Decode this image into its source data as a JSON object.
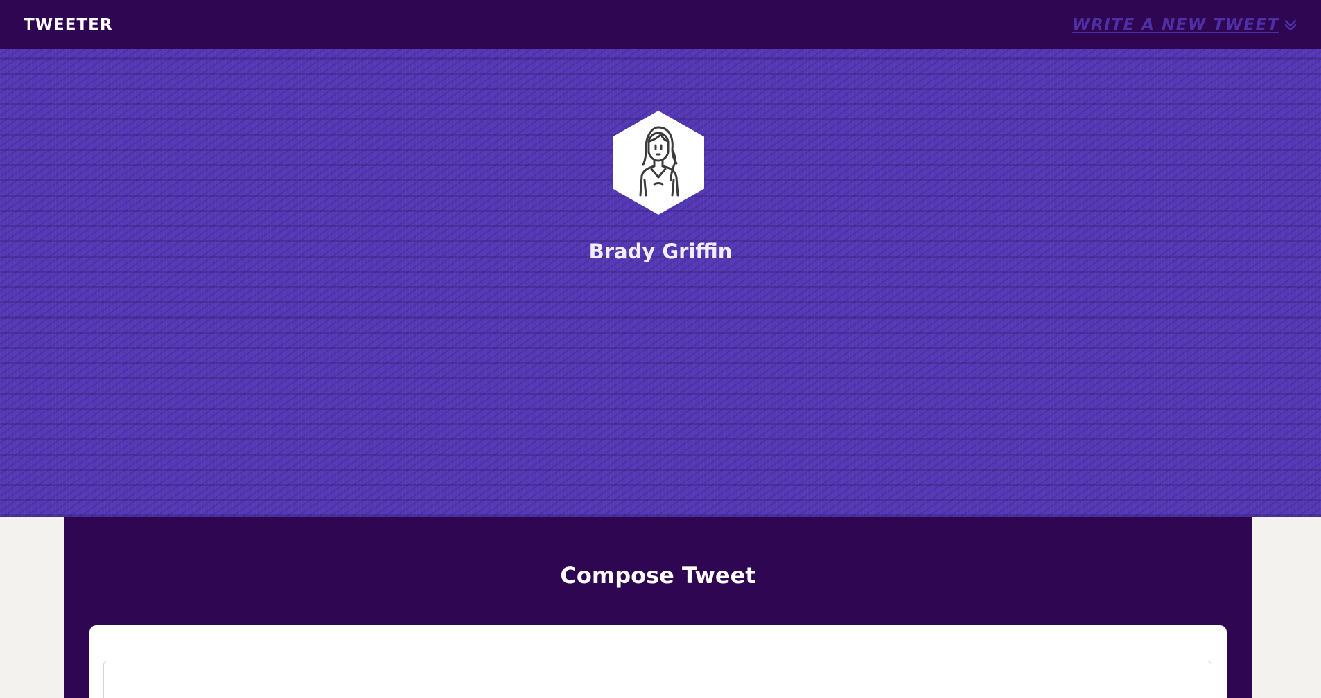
{
  "navbar": {
    "brand": "TWEETER",
    "write_link": "WRITE A NEW TWEET",
    "write_icon": "double-chevron-down-icon"
  },
  "profile": {
    "name": "Brady Griffin",
    "avatar_icon": "woman-avatar-icon"
  },
  "compose": {
    "title": "Compose Tweet",
    "input_value": "",
    "input_placeholder": ""
  },
  "colors": {
    "navbar_bg": "#2f0652",
    "hero_bg": "#5538b5",
    "link": "#4e2fa6",
    "page_bg": "#f4f2ef"
  }
}
